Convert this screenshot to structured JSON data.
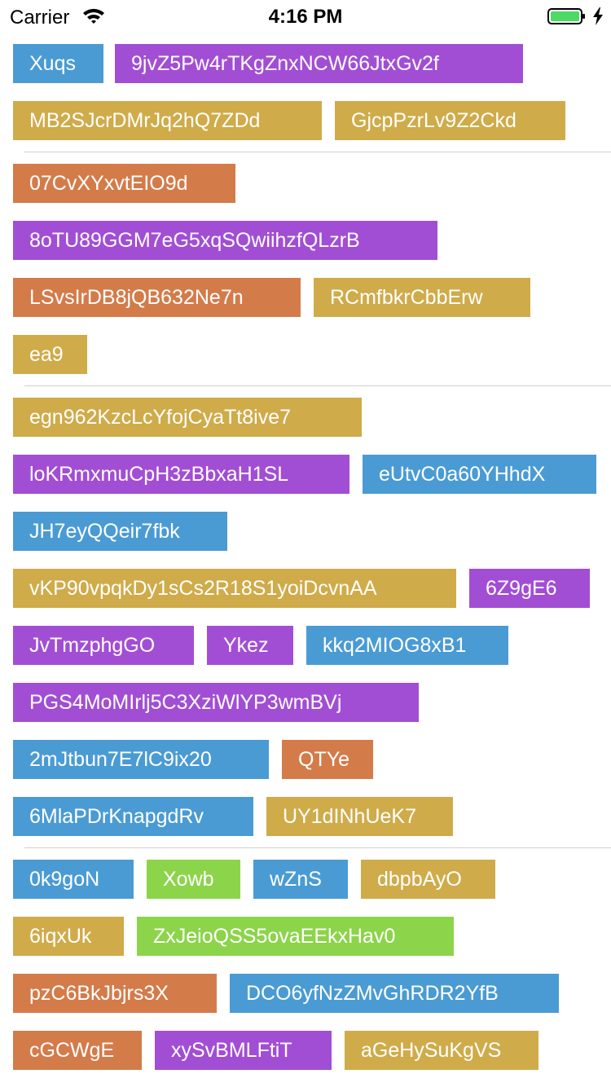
{
  "status_bar": {
    "carrier": "Carrier",
    "time": "4:16 PM",
    "battery_color": "#4cd964",
    "icons": [
      "wifi-icon",
      "battery-icon",
      "charging-icon"
    ]
  },
  "colors": {
    "blue": "#4a9bd4",
    "purple": "#a24ed4",
    "yellow": "#cfab4a",
    "orange": "#d47b4a",
    "green": "#8cd44a",
    "separator": "#d0d0d0"
  },
  "tags": [
    {
      "text": "Xuqs",
      "color": "blue"
    },
    {
      "text": "9jvZ5Pw4rTKgZnxNCW66JtxGv2f",
      "color": "purple"
    },
    {
      "text": "MB2SJcrDMrJq2hQ7ZDd",
      "color": "yellow"
    },
    {
      "text": "GjcpPzrLv9Z2Ckd",
      "color": "yellow"
    },
    {
      "text": "07CvXYxvtEIO9d",
      "color": "orange"
    },
    {
      "text": "8oTU89GGM7eG5xqSQwiihzfQLzrB",
      "color": "purple"
    },
    {
      "text": "LSvsIrDB8jQB632Ne7n",
      "color": "orange"
    },
    {
      "text": "RCmfbkrCbbErw",
      "color": "yellow"
    },
    {
      "text": "ea9",
      "color": "yellow"
    },
    {
      "text": "egn962KzcLcYfojCyaTt8ive7",
      "color": "yellow"
    },
    {
      "text": "loKRmxmuCpH3zBbxaH1SL",
      "color": "purple"
    },
    {
      "text": "eUtvC0a60YHhdX",
      "color": "blue"
    },
    {
      "text": "JH7eyQQeir7fbk",
      "color": "blue"
    },
    {
      "text": "vKP90vpqkDy1sCs2R18S1yoiDcvnAA",
      "color": "yellow"
    },
    {
      "text": "6Z9gE6",
      "color": "purple"
    },
    {
      "text": "JvTmzphgGO",
      "color": "purple"
    },
    {
      "text": "Ykez",
      "color": "purple"
    },
    {
      "text": "kkq2MIOG8xB1",
      "color": "blue"
    },
    {
      "text": "PGS4MoMIrlj5C3XziWlYP3wmBVj",
      "color": "purple"
    },
    {
      "text": "2mJtbun7E7lC9ix20",
      "color": "blue"
    },
    {
      "text": "QTYe",
      "color": "orange"
    },
    {
      "text": "6MlaPDrKnapgdRv",
      "color": "blue"
    },
    {
      "text": "UY1dINhUeK7",
      "color": "yellow"
    },
    {
      "text": "0k9goN",
      "color": "blue"
    },
    {
      "text": "Xowb",
      "color": "green"
    },
    {
      "text": "wZnS",
      "color": "blue"
    },
    {
      "text": "dbpbAyO",
      "color": "yellow"
    },
    {
      "text": "6iqxUk",
      "color": "yellow"
    },
    {
      "text": "ZxJeioQSS5ovaEEkxHav0",
      "color": "green"
    },
    {
      "text": "pzC6BkJbjrs3X",
      "color": "orange"
    },
    {
      "text": "DCO6yfNzZMvGhRDR2YfB",
      "color": "blue"
    },
    {
      "text": "cGCWgE",
      "color": "orange"
    },
    {
      "text": "xySvBMLFtiT",
      "color": "purple"
    },
    {
      "text": "aGeHySuKgVS",
      "color": "yellow"
    }
  ]
}
